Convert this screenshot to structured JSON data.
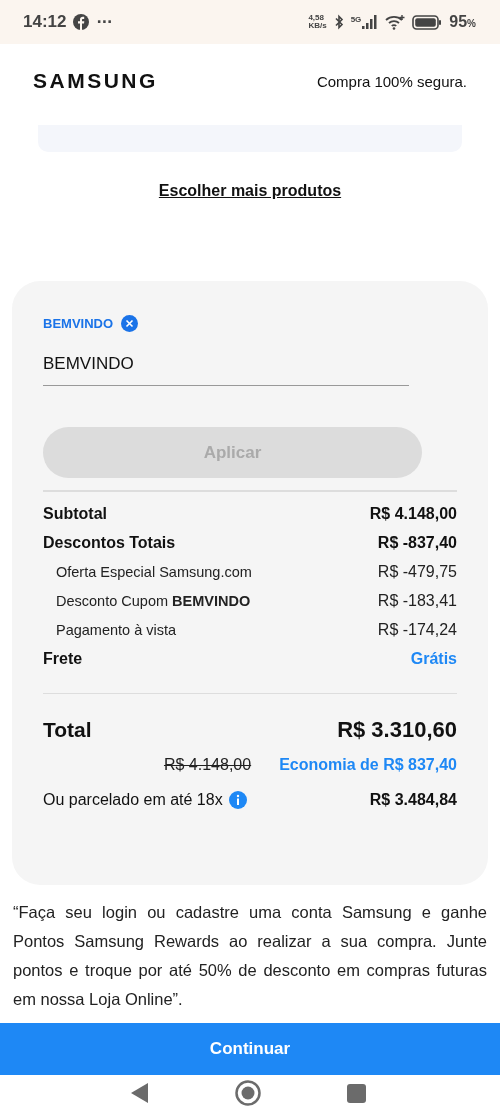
{
  "status_bar": {
    "time": "14:12",
    "more": "···",
    "speed_value": "4,58",
    "speed_unit": "KB/s",
    "network": "5G",
    "battery": "95",
    "battery_unit": "%"
  },
  "header": {
    "logo": "SAMSUNG",
    "secure_text": "Compra 100% segura."
  },
  "more_products_link": "Escolher mais produtos",
  "coupon": {
    "applied_code": "BEMVINDO",
    "input": {
      "value": "BEMVINDO"
    },
    "apply_button": {
      "label": "Aplicar",
      "disabled": true
    }
  },
  "summary_rows": [
    {
      "kind": "main",
      "label": "Subtotal",
      "value": "R$ 4.148,00",
      "highlight": false
    },
    {
      "kind": "main",
      "label": "Descontos Totais",
      "value": "R$ -837,40",
      "highlight": false
    },
    {
      "kind": "sub",
      "label": "Oferta Especial Samsung.com",
      "value": "R$ -479,75",
      "highlight": false
    },
    {
      "kind": "sub",
      "label": "Desconto Cupom **BEMVINDO**",
      "value": "R$ -183,41",
      "highlight": false
    },
    {
      "kind": "sub",
      "label": "Pagamento à vista",
      "value": "R$ -174,24",
      "highlight": false
    },
    {
      "kind": "main",
      "label": "Frete",
      "value": "Grátis",
      "highlight": true
    }
  ],
  "total": {
    "label": "Total",
    "value": "R$ 3.310,60",
    "old_price": "R$ 4.148,00",
    "savings": "Economia de R$ 837,40",
    "installments_label": "Ou parcelado em até 18x",
    "installments_value": "R$ 3.484,84"
  },
  "rewards_note": "“Faça seu login ou cadastre uma conta Samsung e ganhe Pontos Samsung Rewards ao realizar a sua compra. Junte pontos e troque por até 50% de desconto em compras futuras em nossa Loja Online”.",
  "continue_button": "Continuar"
}
